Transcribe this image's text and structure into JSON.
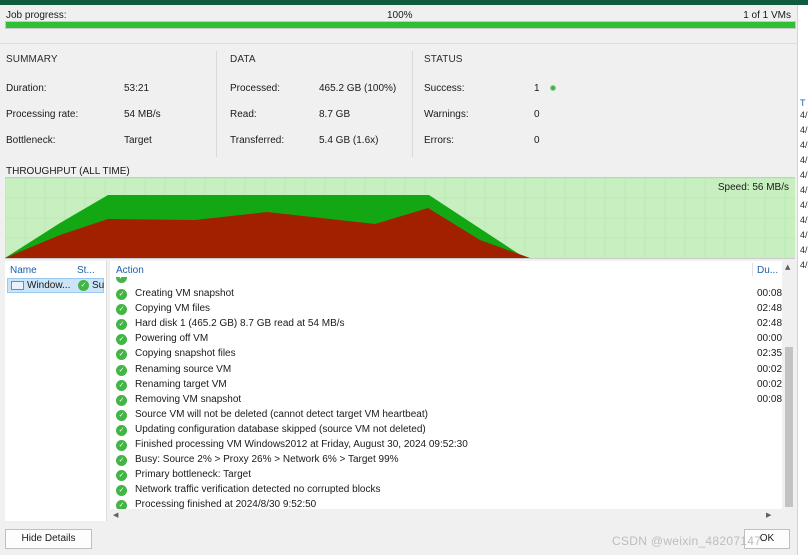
{
  "job": {
    "label": "Job progress:",
    "percent_text": "100%",
    "progress": 1.0,
    "count_text": "1 of 1 VMs"
  },
  "summary": {
    "title": "SUMMARY",
    "rows": [
      {
        "label": "Duration:",
        "value": "53:21"
      },
      {
        "label": "Processing rate:",
        "value": "54 MB/s"
      },
      {
        "label": "Bottleneck:",
        "value": "Target"
      }
    ]
  },
  "data_section": {
    "title": "DATA",
    "rows": [
      {
        "label": "Processed:",
        "value": "465.2 GB (100%)"
      },
      {
        "label": "Read:",
        "value": "8.7 GB"
      },
      {
        "label": "Transferred:",
        "value": "5.4 GB (1.6x)"
      }
    ]
  },
  "status": {
    "title": "STATUS",
    "rows": [
      {
        "label": "Success:",
        "value": "1"
      },
      {
        "label": "Warnings:",
        "value": "0"
      },
      {
        "label": "Errors:",
        "value": "0"
      }
    ],
    "success_color": "#39b54a"
  },
  "throughput": {
    "title": "THROUGHPUT (ALL TIME)",
    "speed_text": "Speed: 56 MB/s",
    "colors": {
      "background": "#c8efc0",
      "outer": "#13a813",
      "inner": "#a12000"
    }
  },
  "vm_list": {
    "col_name": "Name",
    "col_status": "St...",
    "items": [
      {
        "name": "Window...",
        "status": "Su"
      }
    ]
  },
  "actions": {
    "col_action": "Action",
    "col_duration": "Du...",
    "rows": [
      {
        "text": "Creating VM snapshot",
        "dur": "00:08"
      },
      {
        "text": "Copying VM files",
        "dur": "02:48"
      },
      {
        "text": "Hard disk 1 (465.2 GB) 8.7 GB read at 54 MB/s",
        "dur": "02:48"
      },
      {
        "text": "Powering off VM",
        "dur": "00:00"
      },
      {
        "text": "Copying snapshot files",
        "dur": "02:35"
      },
      {
        "text": "Renaming source VM",
        "dur": "00:02"
      },
      {
        "text": "Renaming target VM",
        "dur": "00:02"
      },
      {
        "text": "Removing VM snapshot",
        "dur": "00:08"
      },
      {
        "text": "Source VM will not be deleted (cannot detect target VM heartbeat)",
        "dur": ""
      },
      {
        "text": "Updating configuration database skipped (source VM not deleted)",
        "dur": ""
      },
      {
        "text": "Finished processing VM Windows2012 at Friday, August 30, 2024 09:52:30",
        "dur": ""
      },
      {
        "text": "Busy: Source 2% > Proxy 26% > Network 6% > Target 99%",
        "dur": ""
      },
      {
        "text": "Primary bottleneck: Target",
        "dur": ""
      },
      {
        "text": "Network traffic verification detected no corrupted blocks",
        "dur": ""
      },
      {
        "text": "Processing finished at 2024/8/30 9:52:50",
        "dur": ""
      }
    ]
  },
  "buttons": {
    "hide_details": "Hide Details",
    "ok": "OK"
  },
  "watermark": "CSDN @weixin_48207147",
  "right_edge_chars": [
    "T",
    "4/",
    "4/",
    "4/",
    "4/",
    "4/",
    "4/",
    "4/",
    "4/",
    "4/",
    "4/",
    "4/"
  ]
}
